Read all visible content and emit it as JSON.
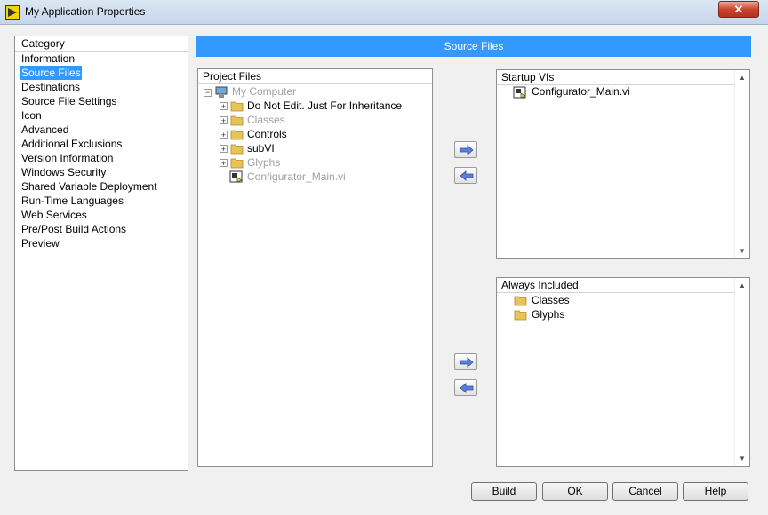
{
  "window": {
    "title": "My Application Properties",
    "close_glyph": "✕"
  },
  "banner": {
    "title": "Source Files"
  },
  "category": {
    "header": "Category",
    "items": [
      {
        "label": "Information"
      },
      {
        "label": "Source Files",
        "selected": true
      },
      {
        "label": "Destinations"
      },
      {
        "label": "Source File Settings"
      },
      {
        "label": "Icon"
      },
      {
        "label": "Advanced"
      },
      {
        "label": "Additional Exclusions"
      },
      {
        "label": "Version Information"
      },
      {
        "label": "Windows Security"
      },
      {
        "label": "Shared Variable Deployment"
      },
      {
        "label": "Run-Time Languages"
      },
      {
        "label": "Web Services"
      },
      {
        "label": "Pre/Post Build Actions"
      },
      {
        "label": "Preview"
      }
    ]
  },
  "project_files": {
    "header": "Project Files",
    "root": "My Computer",
    "items": [
      {
        "label": "Do Not Edit. Just For Inheritance",
        "dim": false,
        "icon": "folder-icon"
      },
      {
        "label": "Classes",
        "dim": true,
        "icon": "folder-icon"
      },
      {
        "label": "Controls",
        "dim": false,
        "icon": "folder-icon"
      },
      {
        "label": "subVI",
        "dim": false,
        "icon": "folder-icon"
      },
      {
        "label": "Glyphs",
        "dim": true,
        "icon": "folder-icon"
      },
      {
        "label": "Configurator_Main.vi",
        "dim": true,
        "icon": "vi-file-icon"
      }
    ]
  },
  "startup_vis": {
    "header": "Startup VIs",
    "items": [
      "Configurator_Main.vi"
    ]
  },
  "always_included": {
    "header": "Always Included",
    "items": [
      "Classes",
      "Glyphs"
    ]
  },
  "buttons": {
    "build": "Build",
    "ok": "OK",
    "cancel": "Cancel",
    "help": "Help"
  },
  "colors": {
    "accent": "#3399ff",
    "folder": "#e8c35a"
  }
}
